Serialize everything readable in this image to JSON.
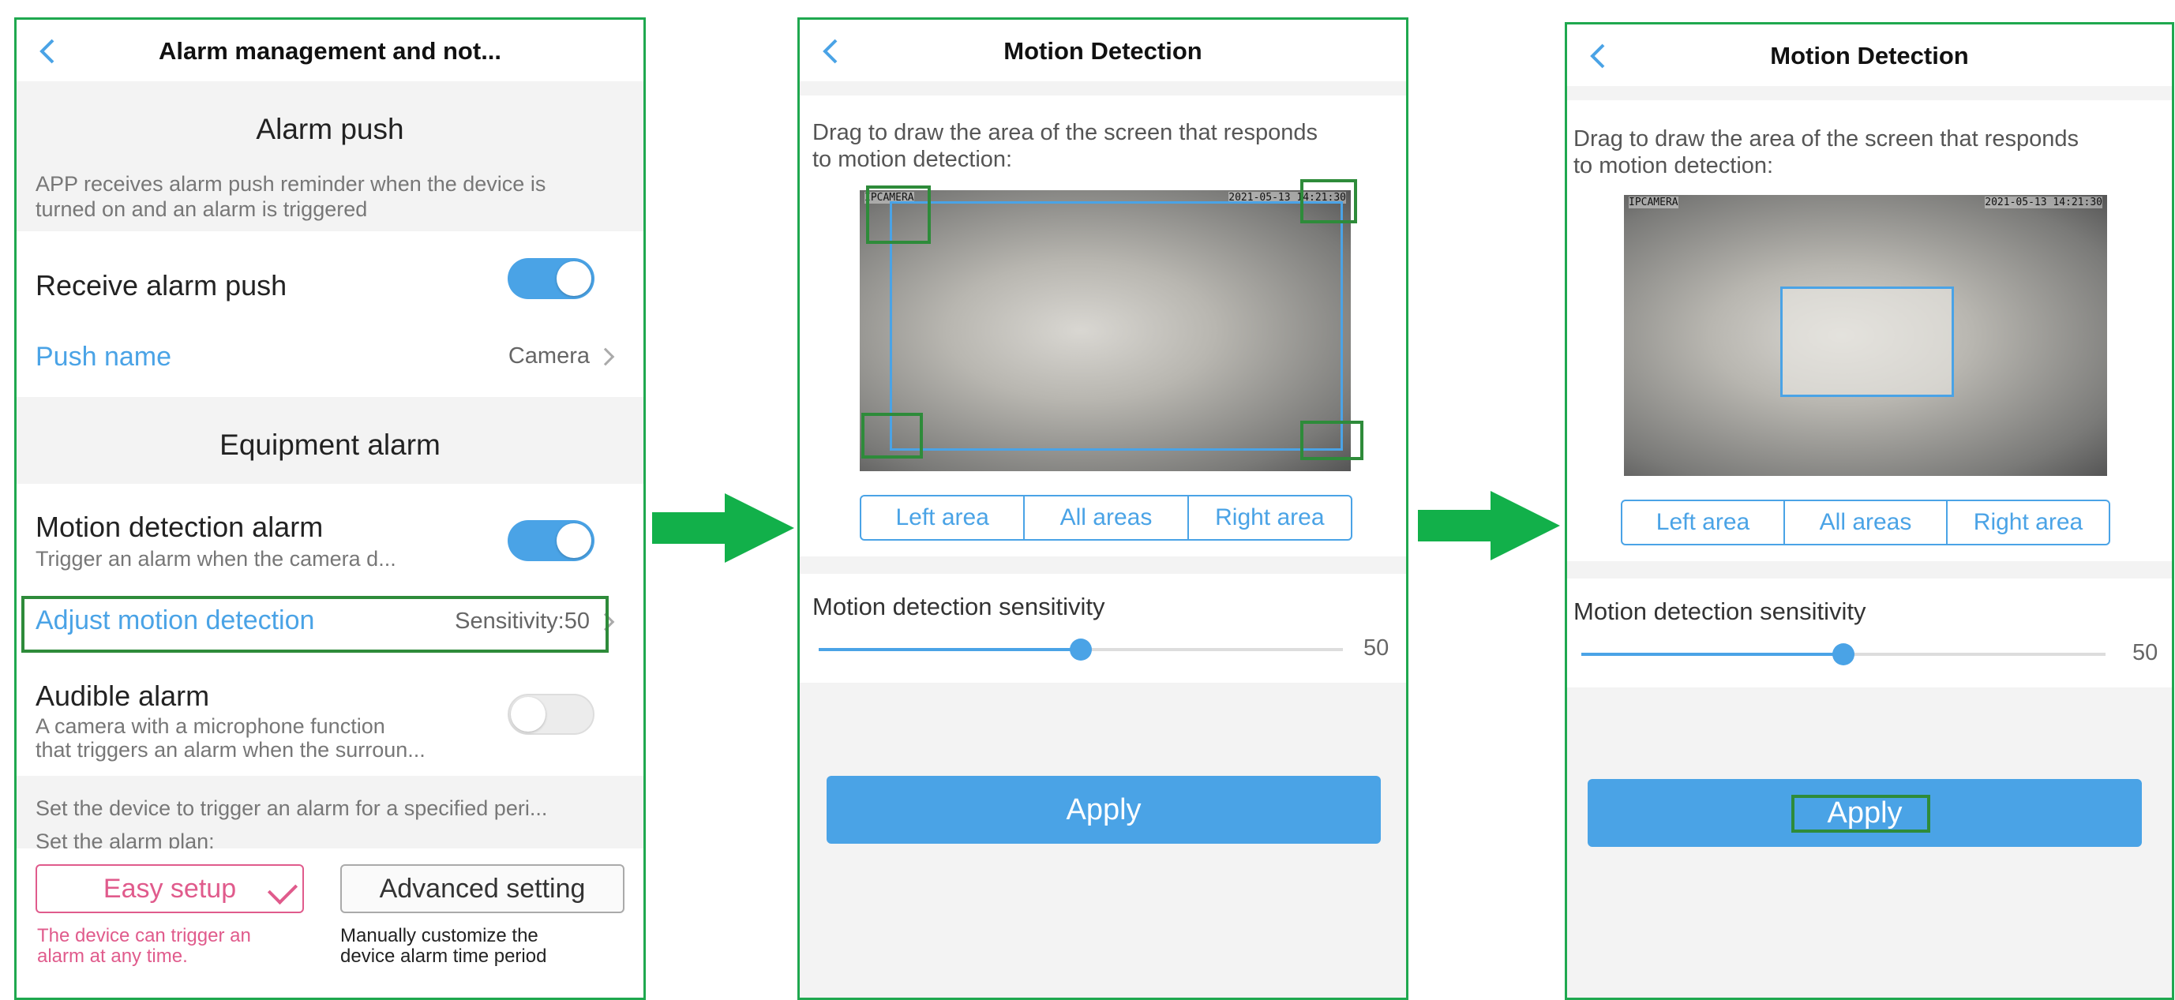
{
  "panel1": {
    "title": "Alarm management and not...",
    "alarm_push_title": "Alarm push",
    "alarm_push_hint_1": "APP receives alarm push reminder when the device is",
    "alarm_push_hint_2": "turned on and an alarm is triggered",
    "receive_alarm_push": "Receive alarm push",
    "push_name_label": "Push name",
    "push_name_value": "Camera",
    "equipment_alarm_title": "Equipment alarm",
    "motion_alarm_label": "Motion detection alarm",
    "motion_alarm_sub": "Trigger an alarm when the camera d...",
    "adjust_motion_label": "Adjust motion detection",
    "adjust_motion_value": "Sensitivity:50",
    "audible_alarm_label": "Audible alarm",
    "audible_alarm_sub_1": "A camera with a microphone function",
    "audible_alarm_sub_2": "that triggers an alarm when the surroun...",
    "plan_hint_1": "Set the device to trigger an alarm for a specified peri...",
    "plan_hint_2": "Set the alarm plan:",
    "easy_setup": "Easy setup",
    "advanced_setting": "Advanced setting",
    "easy_desc_1": "The device can trigger an",
    "easy_desc_2": "alarm at any time.",
    "adv_desc_1": "Manually customize the",
    "adv_desc_2": "device alarm time period",
    "toggles": {
      "receive_alarm_push": true,
      "motion_detection_alarm": true,
      "audible_alarm": false
    }
  },
  "panel2": {
    "title": "Motion Detection",
    "drag_hint_1": "Drag to draw the area of the screen that responds",
    "drag_hint_2": "to motion detection:",
    "cam_label_left": "IPCAMERA",
    "cam_label_right": "2021-05-13 14:21:30",
    "left_area": "Left area",
    "all_areas": "All areas",
    "right_area": "Right area",
    "sensitivity_label": "Motion detection sensitivity",
    "sensitivity_value": "50",
    "apply": "Apply"
  },
  "panel3": {
    "title": "Motion Detection",
    "drag_hint_1": "Drag to draw the area of the screen that responds",
    "drag_hint_2": "to motion detection:",
    "cam_label_left": "IPCAMERA",
    "cam_label_right": "2021-05-13 14:21:30",
    "left_area": "Left area",
    "all_areas": "All areas",
    "right_area": "Right area",
    "sensitivity_label": "Motion detection sensitivity",
    "sensitivity_value": "50",
    "apply": "Apply"
  },
  "sensitivity": {
    "value": 50,
    "max": 100
  },
  "colors": {
    "accent": "#4aa3e6",
    "highlight": "#2e8b3a",
    "frame": "#1fa84f",
    "pink": "#e05b8c",
    "arrow": "#12b04a"
  }
}
